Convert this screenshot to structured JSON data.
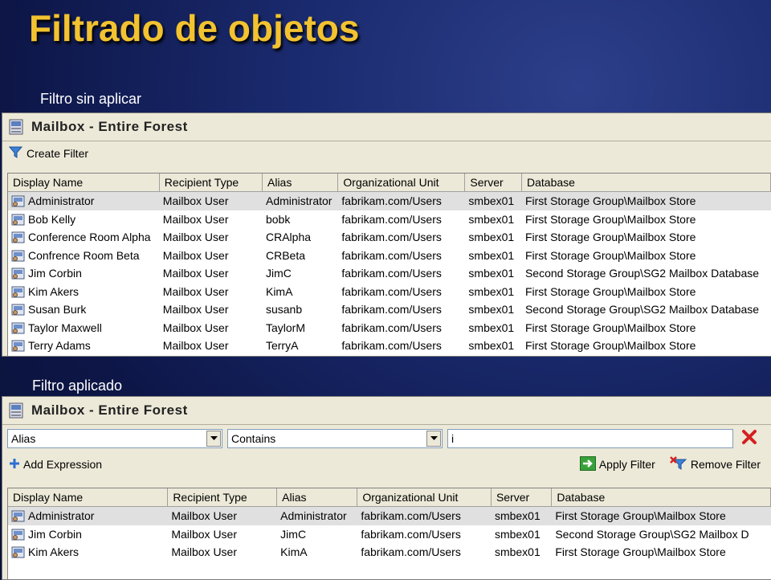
{
  "slide": {
    "title": "Filtrado de objetos",
    "caption_unfiltered": "Filtro sin aplicar",
    "caption_filtered": "Filtro aplicado"
  },
  "panel_unfiltered": {
    "title": "Mailbox - Entire Forest",
    "create_filter_label": "Create Filter",
    "columns": [
      "Display Name",
      "Recipient Type",
      "Alias",
      "Organizational Unit",
      "Server",
      "Database"
    ],
    "rows": [
      [
        "Administrator",
        "Mailbox User",
        "Administrator",
        "fabrikam.com/Users",
        "smbex01",
        "First Storage Group\\Mailbox Store"
      ],
      [
        "Bob Kelly",
        "Mailbox User",
        "bobk",
        "fabrikam.com/Users",
        "smbex01",
        "First Storage Group\\Mailbox Store"
      ],
      [
        "Conference Room Alpha",
        "Mailbox User",
        "CRAlpha",
        "fabrikam.com/Users",
        "smbex01",
        "First Storage Group\\Mailbox Store"
      ],
      [
        "Confrence Room Beta",
        "Mailbox User",
        "CRBeta",
        "fabrikam.com/Users",
        "smbex01",
        "First Storage Group\\Mailbox Store"
      ],
      [
        "Jim Corbin",
        "Mailbox User",
        "JimC",
        "fabrikam.com/Users",
        "smbex01",
        "Second Storage Group\\SG2 Mailbox Database"
      ],
      [
        "Kim Akers",
        "Mailbox User",
        "KimA",
        "fabrikam.com/Users",
        "smbex01",
        "First Storage Group\\Mailbox Store"
      ],
      [
        "Susan Burk",
        "Mailbox User",
        "susanb",
        "fabrikam.com/Users",
        "smbex01",
        "Second Storage Group\\SG2 Mailbox Database"
      ],
      [
        "Taylor Maxwell",
        "Mailbox User",
        "TaylorM",
        "fabrikam.com/Users",
        "smbex01",
        "First Storage Group\\Mailbox Store"
      ],
      [
        "Terry Adams",
        "Mailbox User",
        "TerryA",
        "fabrikam.com/Users",
        "smbex01",
        "First Storage Group\\Mailbox Store"
      ]
    ]
  },
  "panel_filtered": {
    "title": "Mailbox - Entire Forest",
    "filter_attribute": "Alias",
    "filter_operator": "Contains",
    "filter_value": "i",
    "add_expression_label": "Add Expression",
    "apply_filter_label": "Apply Filter",
    "remove_filter_label": "Remove Filter",
    "columns": [
      "Display Name",
      "Recipient Type",
      "Alias",
      "Organizational Unit",
      "Server",
      "Database"
    ],
    "rows": [
      [
        "Administrator",
        "Mailbox User",
        "Administrator",
        "fabrikam.com/Users",
        "smbex01",
        "First Storage Group\\Mailbox Store"
      ],
      [
        "Jim Corbin",
        "Mailbox User",
        "JimC",
        "fabrikam.com/Users",
        "smbex01",
        "Second Storage Group\\SG2 Mailbox D"
      ],
      [
        "Kim Akers",
        "Mailbox User",
        "KimA",
        "fabrikam.com/Users",
        "smbex01",
        "First Storage Group\\Mailbox Store"
      ]
    ]
  },
  "colors": {
    "title": "#f2c230",
    "panel_bg": "#ece9d8",
    "remove_x": "#d42020"
  },
  "icons": [
    "mailbox-panel-icon",
    "funnel-icon",
    "mailbox-user-icon",
    "dropdown-arrow-icon",
    "remove-x-icon",
    "plus-icon",
    "apply-arrow-icon",
    "funnel-remove-icon"
  ]
}
